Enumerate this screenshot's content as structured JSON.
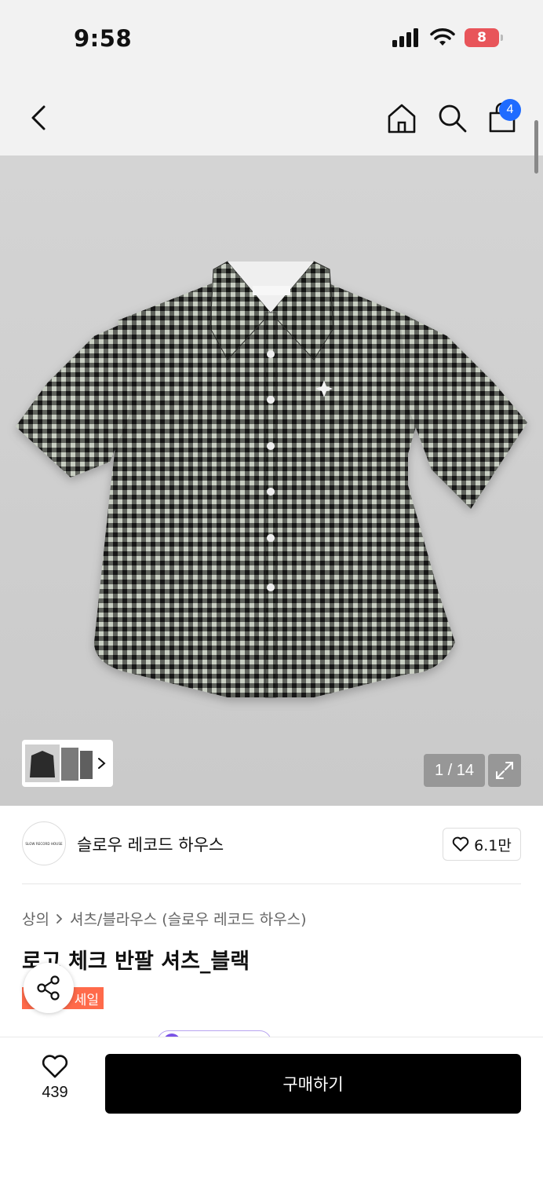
{
  "status_bar": {
    "time": "9:58",
    "battery": "8"
  },
  "nav": {
    "cart_count": "4"
  },
  "gallery": {
    "counter": "1 / 14"
  },
  "brand": {
    "logo_text": "SLOW RECORD HOUSE",
    "name": "슬로우 레코드 하우스",
    "likes": "6.1만"
  },
  "breadcrumb": {
    "category": "상의",
    "subcategory": "셔츠/블라우스 (슬로우 레코드 하우스)"
  },
  "product": {
    "title": "로고 체크 반팔 셔츠_블랙",
    "badge": "세일"
  },
  "bottom_bar": {
    "wish_count": "439",
    "buy_label": "구매하기"
  },
  "colors": {
    "accent_blue": "#1f6bff",
    "sale": "#ff6a4a",
    "battery_low": "#e8555a",
    "button": "#000000"
  }
}
